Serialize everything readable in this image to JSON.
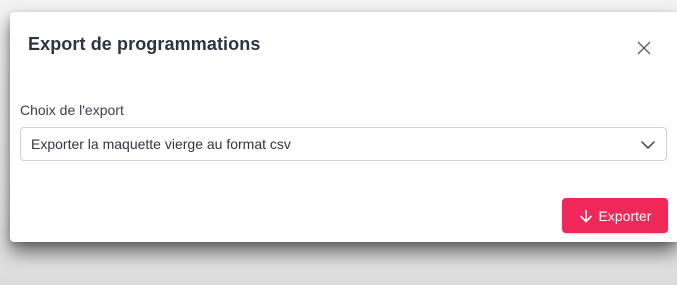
{
  "modal": {
    "title": "Export de programmations",
    "close_icon": "close-icon"
  },
  "form": {
    "export_choice_label": "Choix de l'export",
    "export_choice_value": "Exporter la maquette vierge au format csv",
    "chevron_icon": "chevron-down-icon"
  },
  "actions": {
    "export_label": "Exporter",
    "export_icon": "arrow-down-icon",
    "export_color": "#f0285a"
  }
}
